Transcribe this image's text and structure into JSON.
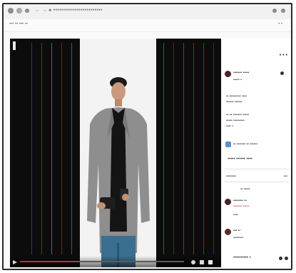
{
  "browser": {
    "url_text": "← → ● •••••••••••••••••••••••••",
    "nav_text": "••• •• ••• ••",
    "nav_right": "• •"
  },
  "video": {
    "progress_fraction": 0.32,
    "accent_color": "#e02020",
    "background_color": "#0c0c0c",
    "presenter_jacket_color": "#8e8e8e",
    "presenter_pants_color": "#3a6f8f"
  },
  "sidebar": {
    "top_icons": "• • •",
    "comment1": {
      "name": "••••••• •••••",
      "line1": "••••• •",
      "line2": "•• ••••••••• ••••",
      "line3": "•••••• ••••••",
      "line4": "•• •• ••••••• •••••",
      "line5": "••••• •••••••••",
      "line6": "•••• •"
    },
    "reactions_line": "•• ••••••• •• ••••••",
    "actions_line": "••••• •••••• ••••",
    "section_label": "••••••••",
    "section_right": "•••",
    "sort_label": "•• •••••",
    "comment2": {
      "name": "•••••••• ••",
      "line1": "••••••• •••••",
      "line2": "••••"
    },
    "comment3": {
      "name": "••• ••",
      "line1": "••••••••"
    },
    "bottom_line": "•••••••••• •"
  }
}
